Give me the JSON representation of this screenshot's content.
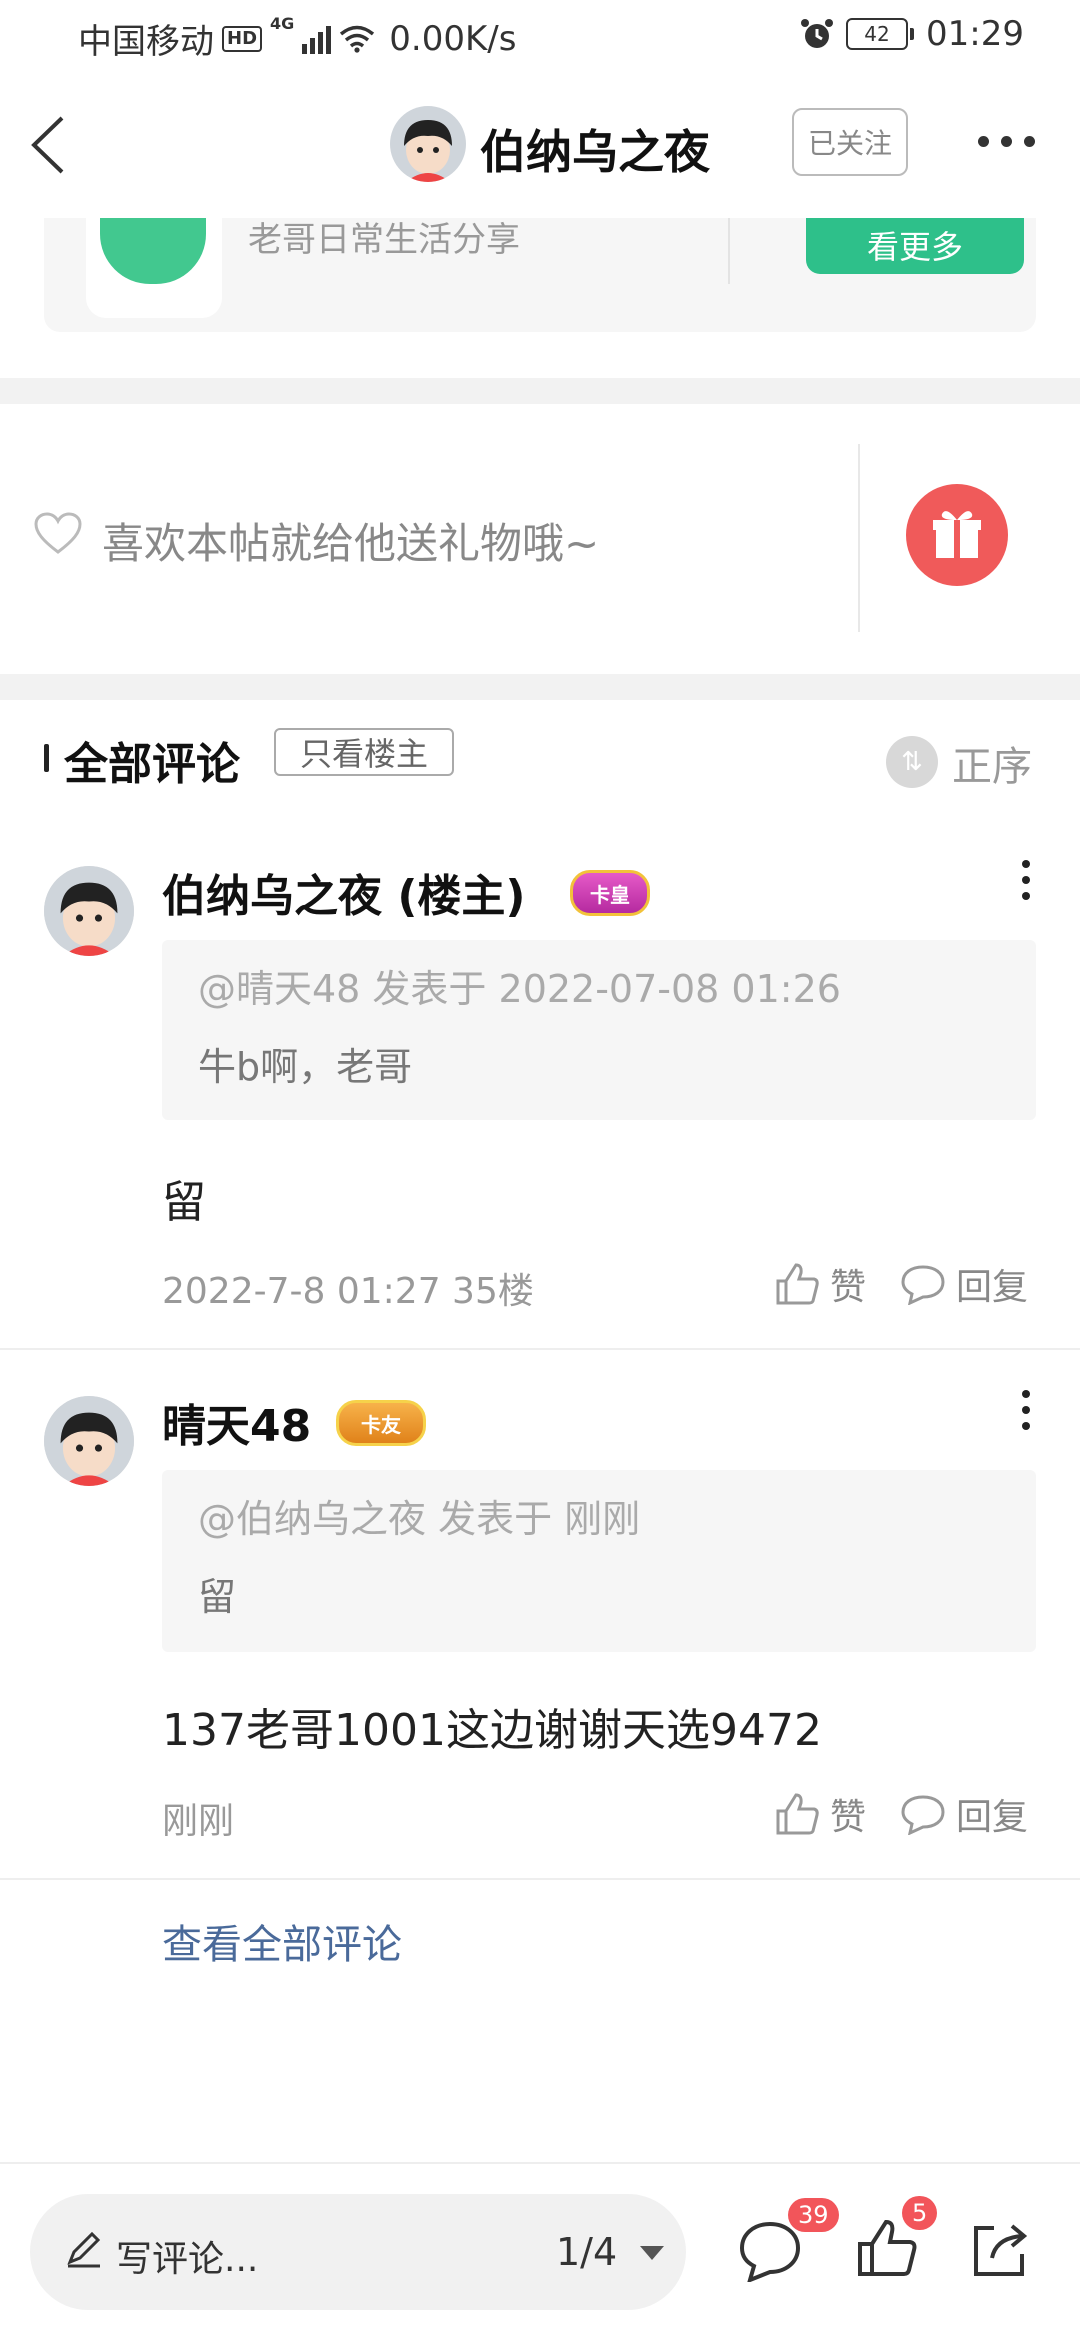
{
  "status_bar": {
    "carrier": "中国移动",
    "hd": "HD",
    "network": "4G",
    "speed": "0.00K/s",
    "battery": "42",
    "time": "01:29"
  },
  "header": {
    "title": "伯纳乌之夜",
    "follow_label": "已关注"
  },
  "promo": {
    "description": "老哥日常生活分享",
    "button_label": "看更多"
  },
  "gift": {
    "prompt": "喜欢本帖就给他送礼物哦~"
  },
  "comments": {
    "title": "全部评论",
    "owner_only_label": "只看楼主",
    "sort_label": "正序",
    "items": [
      {
        "name": "伯纳乌之夜 (楼主)",
        "badge": "卡皇",
        "quote_head": "@晴天48 发表于 2022-07-08 01:26",
        "quote_body": "牛b啊，老哥",
        "text": "留",
        "meta": "2022-7-8 01:27  35楼",
        "like_label": "赞",
        "reply_label": "回复"
      },
      {
        "name": "晴天48",
        "badge": "卡友",
        "quote_head": "@伯纳乌之夜 发表于 刚刚",
        "quote_body": "留",
        "text": "137老哥1001这边谢谢天选9472",
        "meta": "刚刚",
        "like_label": "赞",
        "reply_label": "回复"
      }
    ],
    "view_all_label": "查看全部评论"
  },
  "bottom_bar": {
    "write_placeholder": "写评论...",
    "page_indicator": "1/4",
    "comment_count": "39",
    "like_count": "5"
  },
  "colors": {
    "accent_green": "#2ec08a",
    "gift_red": "#f05a5a",
    "badge_red": "#f2555a",
    "link_blue": "#4a6a9a"
  }
}
